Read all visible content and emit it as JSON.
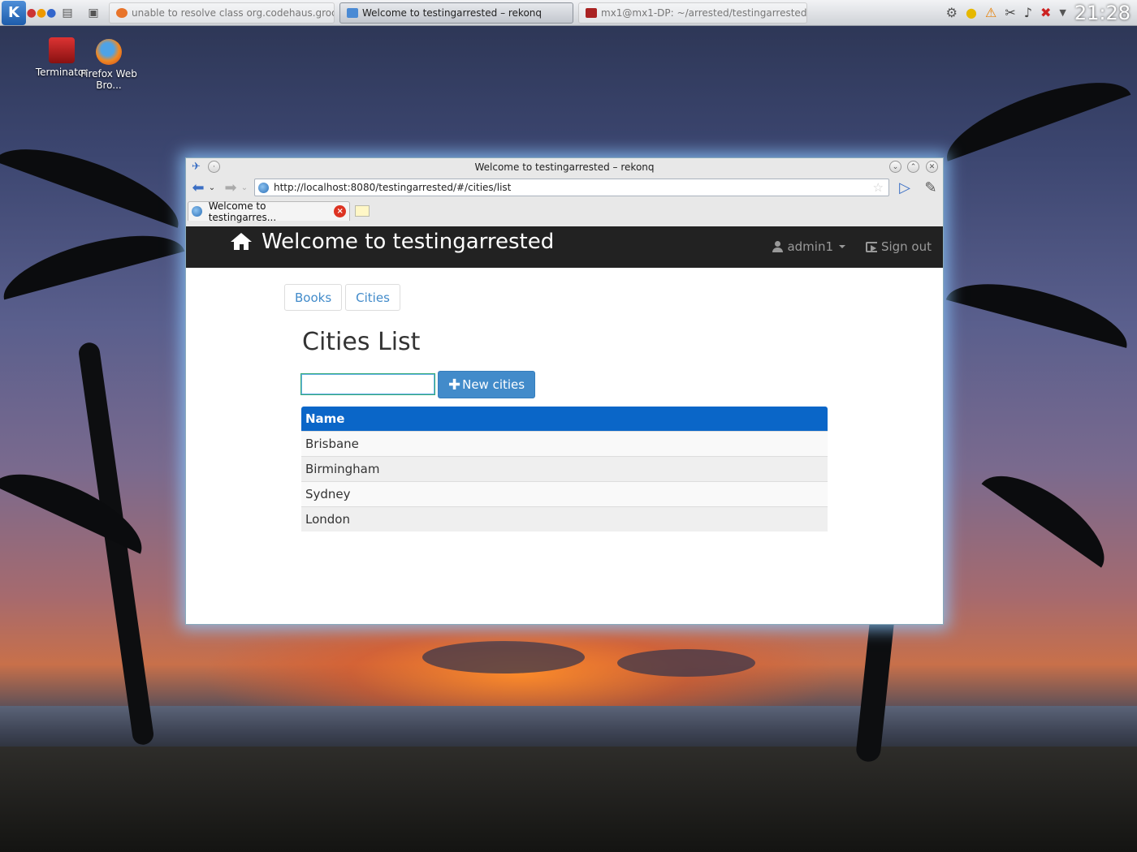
{
  "taskbar": {
    "tasks": [
      {
        "label": "unable to resolve class org.codehaus.groovy.gr",
        "active": false
      },
      {
        "label": "Welcome to testingarrested – rekonq",
        "active": true
      },
      {
        "label": "mx1@mx1-DP: ~/arrested/testingarrested",
        "active": false
      }
    ],
    "clock": "21:28"
  },
  "desktop": {
    "icons": [
      {
        "label": "Terminator"
      },
      {
        "label": "Firefox Web Bro..."
      }
    ]
  },
  "window": {
    "title": "Welcome to testingarrested – rekonq",
    "url": "http://localhost:8080/testingarrested/#/cities/list",
    "tab_label": "Welcome to testingarres..."
  },
  "site": {
    "brand": "Welcome to testingarrested",
    "user": "admin1",
    "signout": "Sign out",
    "nav_pills": [
      "Books",
      "Cities"
    ],
    "heading": "Cities List",
    "search": {
      "value": "",
      "placeholder": ""
    },
    "new_button": "New cities",
    "table": {
      "header": "Name",
      "rows": [
        "Brisbane",
        "Birmingham",
        "Sydney",
        "London"
      ]
    }
  },
  "colors": {
    "navbar": "#222222",
    "accent": "#428bca",
    "table_header": "#0a66c8"
  }
}
